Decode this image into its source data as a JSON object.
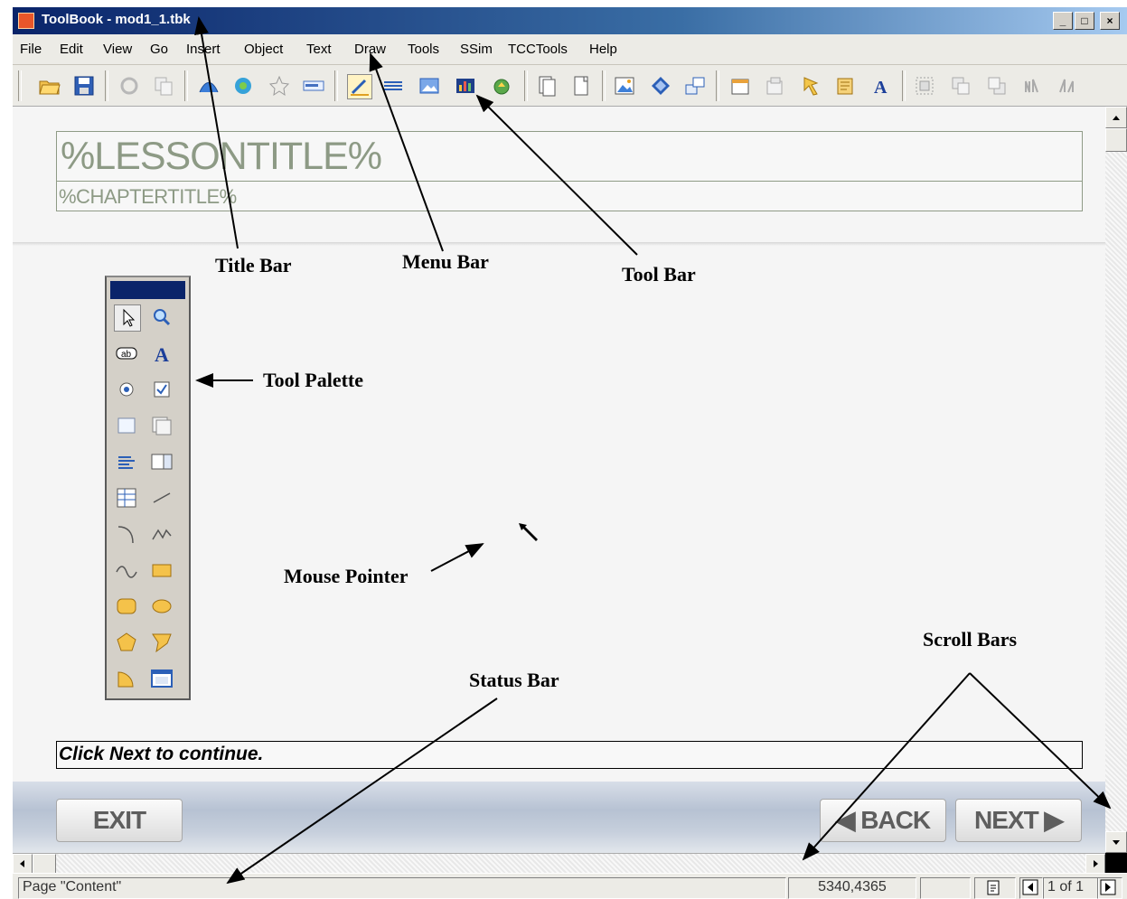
{
  "window": {
    "title": "ToolBook - mod1_1.tbk",
    "minimize_glyph": "_",
    "maximize_glyph": "□",
    "close_glyph": "×"
  },
  "menu": {
    "items": [
      "File",
      "Edit",
      "View",
      "Go",
      "Insert",
      "Object",
      "Text",
      "Draw",
      "Tools",
      "SSim",
      "TCCTools",
      "Help"
    ]
  },
  "toolbar": {
    "icons": [
      "open-folder-icon",
      "save-icon",
      "undo-icon",
      "copy-icon",
      "reader-icon",
      "author-icon",
      "star-icon",
      "field-icon",
      "draw-tool-icon",
      "lines-icon",
      "image-icon",
      "chart-icon",
      "shape-icon",
      "page-icon",
      "new-page-icon",
      "picture-icon",
      "diamond-icon",
      "link-icon",
      "properties-icon",
      "object-icon",
      "script-icon",
      "scroll-icon",
      "text-a-icon",
      "group-icon",
      "bring-front-icon",
      "send-back-icon",
      "align-left-icon",
      "align-right-icon"
    ]
  },
  "document": {
    "lesson_title": "%LESSONTITLE%",
    "chapter_title": "%CHAPTERTITLE%",
    "instruction": "Click Next to continue.",
    "exit_label": "EXIT",
    "back_label": "◀ BACK",
    "next_label": "NEXT ▶"
  },
  "palette": {
    "tools": [
      "pointer-tool-icon",
      "zoom-tool-icon",
      "button-tool-icon",
      "text-tool-icon",
      "radio-tool-icon",
      "checkbox-tool-icon",
      "field-tool-icon",
      "record-field-tool-icon",
      "list-tool-icon",
      "combo-tool-icon",
      "grid-tool-icon",
      "line-tool-icon",
      "arc-tool-icon",
      "polyline-tool-icon",
      "curve-tool-icon",
      "rectangle-tool-icon",
      "rounded-rectangle-tool-icon",
      "ellipse-tool-icon",
      "polygon-tool-icon",
      "irregular-polygon-tool-icon",
      "pie-tool-icon",
      "viewer-tool-icon"
    ]
  },
  "statusbar": {
    "page": "Page \"Content\"",
    "coords": "5340,4365",
    "page_count": "1 of 1"
  },
  "annotations": {
    "title_bar": "Title Bar",
    "menu_bar": "Menu Bar",
    "tool_bar": "Tool Bar",
    "tool_palette": "Tool Palette",
    "mouse_pointer": "Mouse Pointer",
    "status_bar": "Status Bar",
    "scroll_bars": "Scroll Bars"
  },
  "colors": {
    "title_bar": "#0a246a",
    "chrome": "#ecebe6",
    "template_text": "#8d9a85"
  }
}
